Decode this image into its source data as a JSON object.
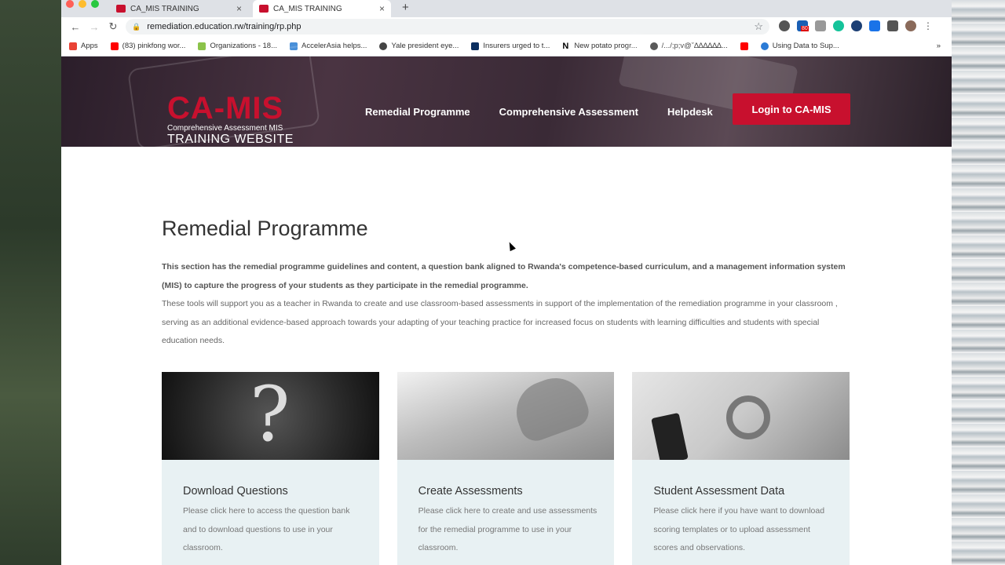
{
  "browser": {
    "tabs": [
      {
        "title": "CA_MIS TRAINING"
      },
      {
        "title": "CA_MIS TRAINING"
      }
    ],
    "url": "remediation.education.rw/training/rp.php",
    "ext_badge": "80",
    "bookmarks": [
      "Apps",
      "(83) pinkfong wor...",
      "Organizations - 18...",
      "AccelerAsia helps...",
      "Yale president eye...",
      "Insurers urged to t...",
      "New potato progr...",
      "/.../;p;v@ˇ∆∆∆∆∆∆...",
      "",
      "Using Data to Sup..."
    ]
  },
  "site": {
    "logo": {
      "main": "CA-MIS",
      "sub": "Comprehensive Assessment MIS",
      "sub2": "TRAINING WEBSITE"
    },
    "nav": [
      "Remedial Programme",
      "Comprehensive Assessment",
      "Helpdesk"
    ],
    "login_label": "Login to CA-MIS"
  },
  "page": {
    "title": "Remedial Programme",
    "intro_bold": "This section has the remedial programme guidelines and content, a question bank aligned to Rwanda's competence-based curriculum, and a management information system (MIS) to capture the progress of your students as they participate in the remedial programme.",
    "intro_text": "These tools will support you as a teacher in Rwanda to create and use classroom-based assessments in support of the implementation of the remediation programme in your classroom , serving as an additional evidence-based approach towards your adapting of your teaching practice for increased focus on students with learning difficulties and students with special education needs.",
    "cards": [
      {
        "title": "Download Questions",
        "text": "Please click here to access the question bank and to download questions to use in your classroom."
      },
      {
        "title": "Create Assessments",
        "text": "Please click here to create and use assessments for the remedial programme to use in your classroom."
      },
      {
        "title": "Student Assessment Data",
        "text": "Please click here if you have want to download scoring templates or to upload assessment scores and observations."
      }
    ]
  },
  "colors": {
    "brand": "#c8102e",
    "card_bg": "#e8f1f3"
  }
}
